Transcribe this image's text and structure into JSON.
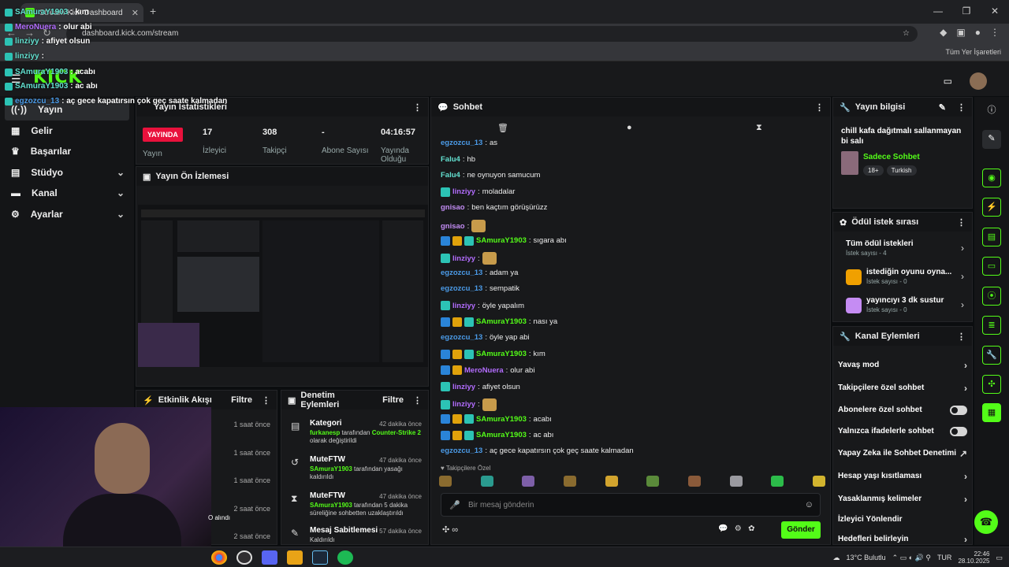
{
  "browser": {
    "tab_title": "Stream Kick Dashboard",
    "url": "dashboard.kick.com/stream",
    "bookmarks_label": "Tüm Yer İşaretleri"
  },
  "brand": {
    "logo_text": "KICK",
    "accent": "#53fc18"
  },
  "overlay_chat": [
    {
      "user": "SAmuraY1903",
      "text": ": kım"
    },
    {
      "user": "MeroNuera",
      "text": ": olur abi"
    },
    {
      "user": "linziyy",
      "text": ": afiyet olsun"
    },
    {
      "user": "linziyy",
      "text": ":"
    },
    {
      "user": "SAmuraY1903",
      "text": ": acabı"
    },
    {
      "user": "SAmuraY1903",
      "text": ": ac abı"
    },
    {
      "user": "egzozcu_13",
      "text": ": aç gece kapatırsın çok geç saate kalmadan"
    }
  ],
  "leftnav": {
    "items": [
      {
        "label": "Yayın",
        "icon": "broadcast-icon"
      },
      {
        "label": "Gelir",
        "icon": "revenue-icon"
      },
      {
        "label": "Başarılar",
        "icon": "trophy-icon"
      },
      {
        "label": "Stüdyo",
        "icon": "studio-icon"
      },
      {
        "label": "Kanal",
        "icon": "channel-icon"
      },
      {
        "label": "Ayarlar",
        "icon": "gear-icon"
      }
    ]
  },
  "stats": {
    "title": "Yayın İstatistikleri",
    "live_label": "YAYINDA",
    "live_sub": "Yayın",
    "viewers": "17",
    "viewers_label": "İzleyici",
    "followers": "308",
    "followers_label": "Takipçi",
    "subs": "-",
    "subs_label": "Abone Sayısı",
    "uptime": "04:16:57",
    "uptime_label": "Yayında Olduğu"
  },
  "preview": {
    "title": "Yayın Ön İzlemesi"
  },
  "events": {
    "title": "Etkinlik Akışı",
    "filter": "Filtre",
    "rows": [
      "1 saat önce",
      "1 saat önce",
      "1 saat önce",
      "2 saat önce",
      "2 saat önce"
    ],
    "partial_text": "O alındı"
  },
  "moderation": {
    "title": "Denetim Eylemleri",
    "filter": "Filtre",
    "rows": [
      {
        "title": "Kategori",
        "time": "42 dakika önce",
        "user": "furkanesp",
        "mid": " tarafından ",
        "hl": "Counter-Strike 2",
        "tail": " olarak değiştirildi"
      },
      {
        "title": "MuteFTW",
        "time": "47 dakika önce",
        "user": "SAmuraY1903",
        "mid": " tarafından yasağı kaldırıldı",
        "hl": "",
        "tail": ""
      },
      {
        "title": "MuteFTW",
        "time": "47 dakika önce",
        "user": "SAmuraY1903",
        "mid": " tarafından 5 dakika süreliğine sohbetten uzaklaştırıldı",
        "hl": "",
        "tail": ""
      },
      {
        "title": "Mesaj Sabitlemesi",
        "time": "57 dakika önce",
        "user": "",
        "mid": "Kaldırıldı",
        "hl": "",
        "tail": ""
      }
    ]
  },
  "chat": {
    "title": "Sohbet",
    "messages": [
      {
        "user": "egzozcu_13",
        "color": "u-blue",
        "badges": [],
        "text": "as"
      },
      {
        "user": "Falu4",
        "color": "u-teal",
        "badges": [],
        "text": "hb"
      },
      {
        "user": "Falu4",
        "color": "u-teal",
        "badges": [],
        "text": "ne oynuyon samucum"
      },
      {
        "user": "linziyy",
        "color": "u-purple",
        "badges": [
          "b-teal"
        ],
        "text": "moladalar"
      },
      {
        "user": "gnisao",
        "color": "u-pink",
        "badges": [],
        "text": "ben kaçtım görüşürüzz"
      },
      {
        "user": "gnisao",
        "color": "u-pink",
        "badges": [],
        "text": "",
        "emote": true
      },
      {
        "user": "SAmuraY1903",
        "color": "u-green",
        "badges": [
          "b-blue",
          "b-gold",
          "b-teal"
        ],
        "text": "sıgara abı"
      },
      {
        "user": "linziyy",
        "color": "u-purple",
        "badges": [
          "b-teal"
        ],
        "text": "",
        "emote": true
      },
      {
        "user": "egzozcu_13",
        "color": "u-blue",
        "badges": [],
        "text": "adam ya"
      },
      {
        "user": "egzozcu_13",
        "color": "u-blue",
        "badges": [],
        "text": "sempatik"
      },
      {
        "user": "linziyy",
        "color": "u-purple",
        "badges": [
          "b-teal"
        ],
        "text": "öyle yapalım"
      },
      {
        "user": "SAmuraY1903",
        "color": "u-green",
        "badges": [
          "b-blue",
          "b-gold",
          "b-teal"
        ],
        "text": "nası ya"
      },
      {
        "user": "egzozcu_13",
        "color": "u-blue",
        "badges": [],
        "text": "öyle yap abi"
      },
      {
        "user": "SAmuraY1903",
        "color": "u-green",
        "badges": [
          "b-blue",
          "b-gold",
          "b-teal"
        ],
        "text": "kım"
      },
      {
        "user": "MeroNuera",
        "color": "u-purple",
        "badges": [
          "b-blue",
          "b-gold"
        ],
        "text": "olur abi"
      },
      {
        "user": "linziyy",
        "color": "u-purple",
        "badges": [
          "b-teal"
        ],
        "text": "afiyet olsun"
      },
      {
        "user": "linziyy",
        "color": "u-purple",
        "badges": [
          "b-teal"
        ],
        "text": "",
        "emote": true
      },
      {
        "user": "SAmuraY1903",
        "color": "u-green",
        "badges": [
          "b-blue",
          "b-gold",
          "b-teal"
        ],
        "text": "acabı"
      },
      {
        "user": "SAmuraY1903",
        "color": "u-green",
        "badges": [
          "b-blue",
          "b-gold",
          "b-teal"
        ],
        "text": "ac abı"
      },
      {
        "user": "egzozcu_13",
        "color": "u-blue",
        "badges": [],
        "text": "aç gece kapatırsın çok geç saate kalmadan"
      }
    ],
    "emote_section": "Takipçilere Özel",
    "input_placeholder": "Bir mesaj gönderin",
    "send_label": "Gönder"
  },
  "stream_info": {
    "title": "Yayın bilgisi",
    "stream_title": "chill kafa dağıtmalı sallanmayan bi salı",
    "category": "Sadece Sohbet",
    "tags": [
      "18+",
      "Turkish"
    ]
  },
  "rewards": {
    "title": "Ödül istek sırası",
    "items": [
      {
        "title": "Tüm ödül istekleri",
        "sub": "İstek sayısı - 4",
        "color": ""
      },
      {
        "title": "istediğin oyunu oyna...",
        "sub": "İstek sayısı - 0",
        "color": "#f0a000"
      },
      {
        "title": "yayıncıyı 3 dk sustur",
        "sub": "İstek sayısı - 0",
        "color": "#c58cf3"
      }
    ]
  },
  "channel_actions": {
    "title": "Kanal Eylemleri",
    "items": [
      {
        "label": "Yavaş mod",
        "kind": "chev"
      },
      {
        "label": "Takipçilere özel sohbet",
        "kind": "chev"
      },
      {
        "label": "Abonelere özel sohbet",
        "kind": "toggle"
      },
      {
        "label": "Yalnızca ifadelerle sohbet",
        "kind": "toggle"
      },
      {
        "label": "Yapay Zeka ile Sohbet Denetimi",
        "kind": "ext"
      },
      {
        "label": "Hesap yaşı kısıtlaması",
        "kind": "chev"
      },
      {
        "label": "Yasaklanmış kelimeler",
        "kind": "chev"
      },
      {
        "label": "İzleyici Yönlendir",
        "kind": "none"
      },
      {
        "label": "Hedefleri belirleyin",
        "kind": "chev"
      }
    ]
  },
  "taskbar": {
    "weather": "13°C Bulutlu",
    "lang": "TUR",
    "time": "22:46",
    "date": "28.10.2025"
  }
}
